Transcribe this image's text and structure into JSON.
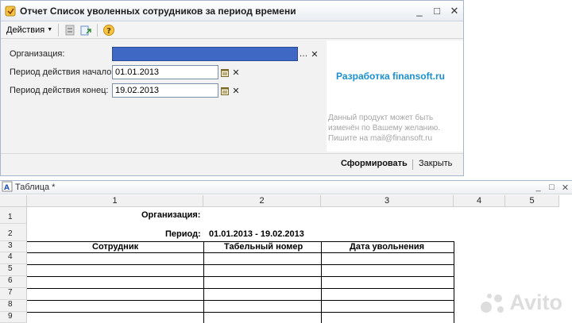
{
  "report_window": {
    "title": "Отчет  Список уволенных сотрудников за период времени",
    "window_buttons": [
      "_",
      "□",
      "✕"
    ],
    "toolbar": {
      "actions_label": "Действия"
    },
    "fields": {
      "organization": {
        "label": "Организация:",
        "value": ""
      },
      "period_start": {
        "label": "Период действия начало:",
        "value": "01.01.2013"
      },
      "period_end": {
        "label": "Период действия конец:",
        "value": "19.02.2013"
      }
    },
    "promo": {
      "title": "Разработка finansoft.ru",
      "note": "Данный продукт может быть изменён по Вашему желанию. Пишите на mail@finansoft.ru"
    },
    "buttons": {
      "generate": "Сформировать",
      "close": "Закрыть"
    }
  },
  "table_window": {
    "title": "Таблица *",
    "window_buttons": [
      "_",
      "□",
      "✕"
    ],
    "columns": [
      "1",
      "2",
      "3",
      "4",
      "5"
    ],
    "rows": [
      "1",
      "2",
      "3",
      "4",
      "5",
      "6",
      "7",
      "8",
      "9"
    ],
    "org_label": "Организация:",
    "period_label": "Период:",
    "period_value": "01.01.2013 - 19.02.2013",
    "table_headers": [
      "Сотрудник",
      "Табельный номер",
      "Дата увольнения"
    ]
  },
  "watermark": {
    "text": "Avito"
  }
}
